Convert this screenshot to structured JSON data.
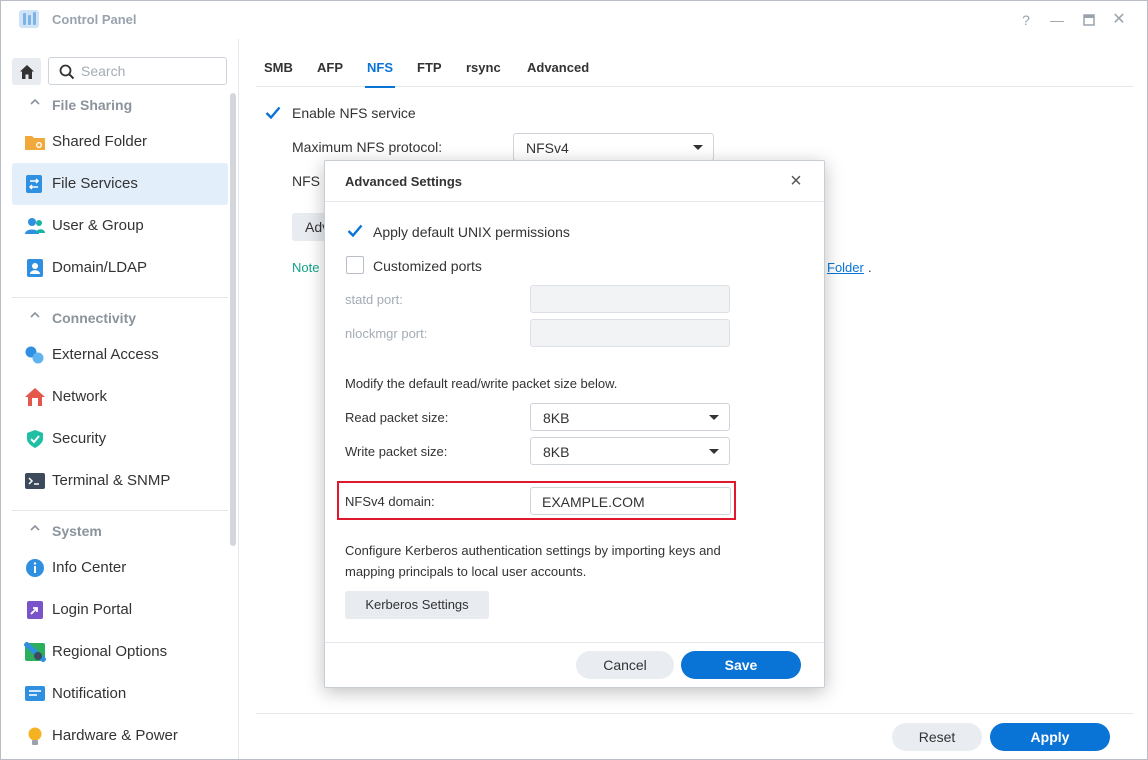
{
  "window": {
    "title": "Control Panel"
  },
  "sidebar": {
    "search_placeholder": "Search",
    "sections": [
      {
        "label": "File Sharing",
        "items": [
          {
            "label": "Shared Folder",
            "icon": "folder-share-icon"
          },
          {
            "label": "File Services",
            "icon": "file-services-icon",
            "active": true
          },
          {
            "label": "User & Group",
            "icon": "user-group-icon"
          },
          {
            "label": "Domain/LDAP",
            "icon": "domain-ldap-icon"
          }
        ]
      },
      {
        "label": "Connectivity",
        "items": [
          {
            "label": "External Access",
            "icon": "external-access-icon"
          },
          {
            "label": "Network",
            "icon": "network-icon"
          },
          {
            "label": "Security",
            "icon": "shield-icon"
          },
          {
            "label": "Terminal & SNMP",
            "icon": "terminal-icon"
          }
        ]
      },
      {
        "label": "System",
        "items": [
          {
            "label": "Info Center",
            "icon": "info-icon"
          },
          {
            "label": "Login Portal",
            "icon": "login-portal-icon"
          },
          {
            "label": "Regional Options",
            "icon": "regional-options-icon"
          },
          {
            "label": "Notification",
            "icon": "notification-icon"
          },
          {
            "label": "Hardware & Power",
            "icon": "bulb-icon"
          }
        ]
      }
    ]
  },
  "main": {
    "tabs": [
      "SMB",
      "AFP",
      "NFS",
      "FTP",
      "rsync",
      "Advanced"
    ],
    "active_tab": "NFS",
    "enable_nfs_label": "Enable NFS service",
    "enable_nfs_checked": true,
    "max_protocol_label": "Maximum NFS protocol:",
    "max_protocol_value": "NFSv4",
    "nfs_partial_label": "NFS r",
    "adv_button_partial": "Adv",
    "note_partial": "Note",
    "link_partial": "Folder",
    "link_suffix": ".",
    "reset_label": "Reset",
    "apply_label": "Apply"
  },
  "modal": {
    "title": "Advanced Settings",
    "apply_unix_label": "Apply default UNIX permissions",
    "apply_unix_checked": true,
    "custom_ports_label": "Customized ports",
    "custom_ports_checked": false,
    "statd_label": "statd port:",
    "nlockmgr_label": "nlockmgr port:",
    "packet_info": "Modify the default read/write packet size below.",
    "read_label": "Read packet size:",
    "read_value": "8KB",
    "write_label": "Write packet size:",
    "write_value": "8KB",
    "nfsv4_domain_label": "NFSv4 domain:",
    "nfsv4_domain_value": "EXAMPLE.COM",
    "kerberos_text_1": "Configure Kerberos authentication settings by importing keys and",
    "kerberos_text_2": "mapping principals to local user accounts.",
    "kerberos_button": "Kerberos Settings",
    "cancel_label": "Cancel",
    "save_label": "Save"
  },
  "colors": {
    "accent": "#0a74d6",
    "highlight": "#e0182d",
    "note": "#12a38a"
  }
}
